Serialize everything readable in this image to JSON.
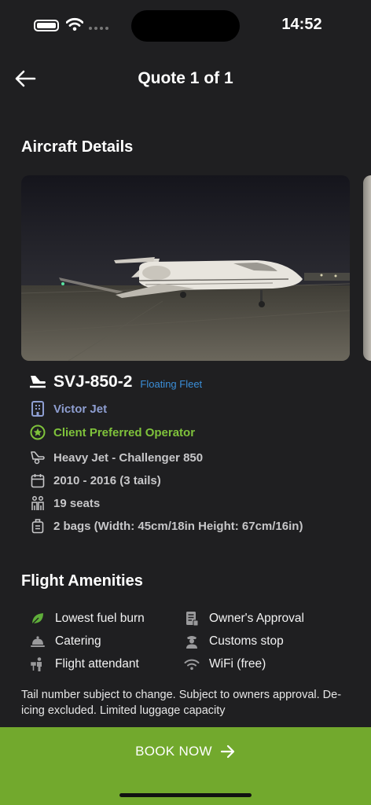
{
  "status": {
    "time": "14:52"
  },
  "header": {
    "title": "Quote 1 of 1"
  },
  "aircraft_section": {
    "title": "Aircraft Details"
  },
  "aircraft": {
    "tail": "SVJ-850-2",
    "fleet_tag": "Floating Fleet",
    "operator": "Victor Jet",
    "preferred": "Client Preferred Operator",
    "category": "Heavy Jet - Challenger 850",
    "years": "2010 - 2016 (3 tails)",
    "seats": "19 seats",
    "bags": "2 bags (Width: 45cm/18in Height: 67cm/16in)"
  },
  "amenities_section": {
    "title": "Flight Amenities"
  },
  "amenities": [
    {
      "label": "Lowest fuel burn",
      "icon": "leaf-icon"
    },
    {
      "label": "Owner's Approval",
      "icon": "document-icon"
    },
    {
      "label": "Catering",
      "icon": "cloche-icon"
    },
    {
      "label": "Customs stop",
      "icon": "officer-icon"
    },
    {
      "label": "Flight attendant",
      "icon": "attendant-icon"
    },
    {
      "label": "WiFi (free)",
      "icon": "wifi-icon"
    }
  ],
  "note": "Tail number subject to change. Subject to owners approval. De-icing excluded. Limited luggage capacity",
  "cta": {
    "label": "BOOK NOW"
  },
  "colors": {
    "accent_green": "#72a92d",
    "operator_blue": "#8e9ed1",
    "fleet_blue": "#3b8fd9",
    "preferred_green": "#7fc23b"
  }
}
